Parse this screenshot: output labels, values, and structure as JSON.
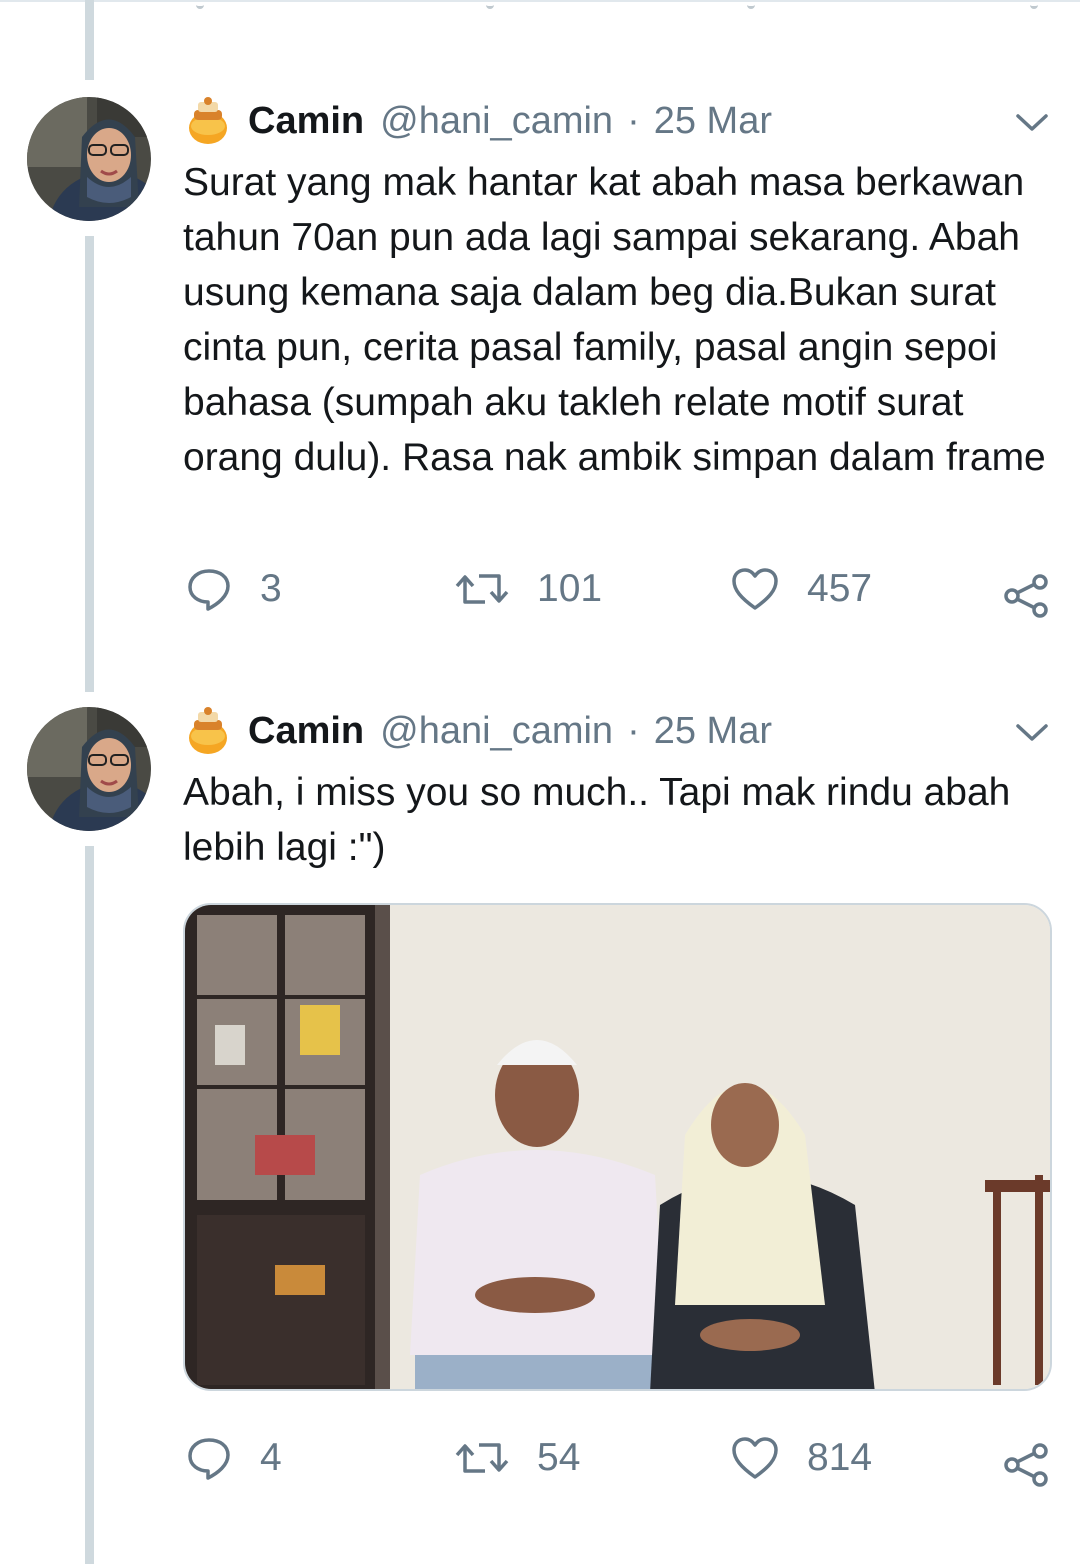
{
  "tweets": [
    {
      "author": {
        "name": "Camin",
        "handle": "@hani_camin",
        "badge_icon": "honey-pot-icon"
      },
      "date": "25 Mar",
      "separator": "·",
      "text": "Surat yang mak hantar kat abah masa berkawan tahun 70an pun ada lagi sampai sekarang. Abah usung kemana saja dalam beg dia.Bukan surat cinta pun, cerita pasal family, pasal angin sepoi bahasa (sumpah aku takleh relate motif surat orang dulu). Rasa nak ambik simpan dalam frame",
      "replies": "3",
      "retweets": "101",
      "likes": "457"
    },
    {
      "author": {
        "name": "Camin",
        "handle": "@hani_camin",
        "badge_icon": "honey-pot-icon"
      },
      "date": "25 Mar",
      "separator": "·",
      "text": "Abah, i miss you so much.. Tapi mak rindu abah lebih lagi :\")",
      "media": "photo",
      "replies": "4",
      "retweets": "54",
      "likes": "814"
    }
  ],
  "colors": {
    "text": "#14171a",
    "secondary": "#657786",
    "thread_line": "#cfd9de"
  }
}
